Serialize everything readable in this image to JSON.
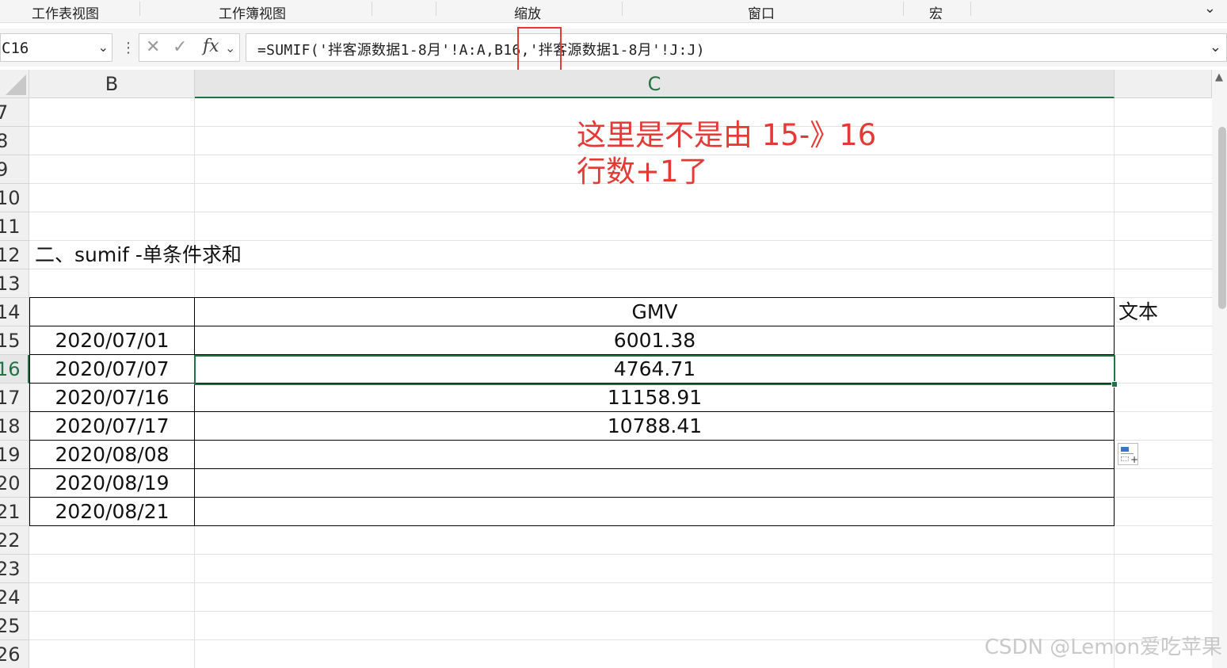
{
  "ribbon": {
    "groups": [
      "工作表视图",
      "工作簿视图",
      "缩放",
      "窗口",
      "宏"
    ]
  },
  "formula_bar": {
    "name_box": "C16",
    "formula_part1": "=SUMIF('拌客源数据1-8月'!A:A,",
    "formula_part2": "B16",
    "formula_part3": ",'拌客源数据1-8月'!J:J)"
  },
  "columns": [
    "B",
    "C"
  ],
  "active_column": "C",
  "rows": [
    "7",
    "8",
    "9",
    "10",
    "11",
    "12",
    "13",
    "14",
    "15",
    "16",
    "17",
    "18",
    "19",
    "20",
    "21",
    "22",
    "23",
    "24",
    "25",
    "26"
  ],
  "active_row": "16",
  "section_title": "二、sumif -单条件求和",
  "table": {
    "header": "GMV",
    "side_label": "文本",
    "dates": [
      "2020/07/01",
      "2020/07/07",
      "2020/07/16",
      "2020/07/17",
      "2020/08/08",
      "2020/08/19",
      "2020/08/21"
    ],
    "values": [
      "6001.38",
      "4764.71",
      "11158.91",
      "10788.41",
      "",
      "",
      ""
    ]
  },
  "annotation": {
    "line1": "这里是不是由 15-》16",
    "line2": "行数+1了"
  },
  "watermark": "CSDN @Lemon爱吃苹果",
  "colors": {
    "accent": "#217346",
    "annotation": "#e53935"
  }
}
